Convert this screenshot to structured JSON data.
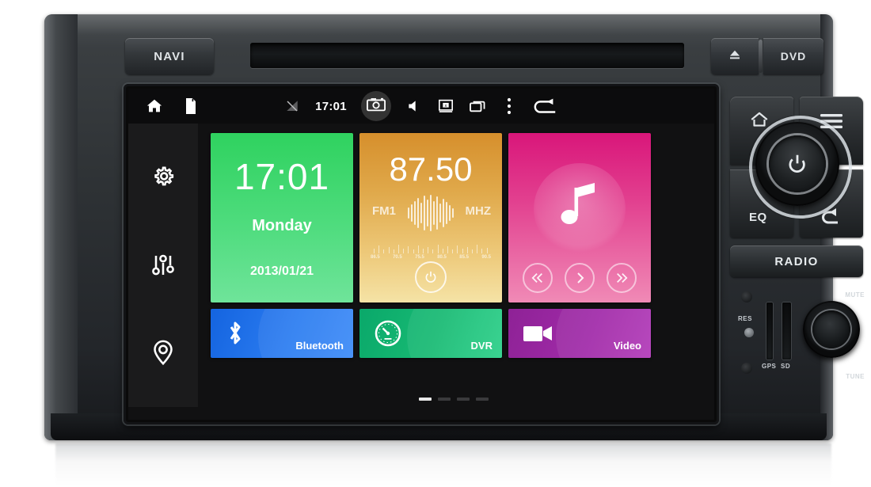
{
  "device": {
    "top_bezel": {
      "navi_label": "NAVI",
      "eject_icon": "eject-icon",
      "dvd_label": "DVD",
      "cd_slot": "cd-slot"
    },
    "right_panel": {
      "home_icon": "home-icon",
      "menu_icon": "menu-icon",
      "power_knob_icon": "power-knob-icon",
      "eq_label": "EQ",
      "back_icon": "back-arrow-icon",
      "radio_label": "RADIO"
    },
    "lower_panel": {
      "res_label": "RES",
      "gps_label": "GPS",
      "sd_label": "SD",
      "mute_label": "MUTE",
      "tune_label": "TUNE"
    }
  },
  "screen": {
    "statusbar": {
      "home_icon": "home-icon",
      "storage_icon": "sd-card-icon",
      "signal_off_icon": "signal-off-icon",
      "time": "17:01",
      "camera_icon": "camera-icon",
      "volume_icon": "volume-icon",
      "screen_off_icon": "screen-off-icon",
      "recents_icon": "recent-apps-icon",
      "overflow_icon": "overflow-menu-icon",
      "back_icon": "back-arrow-icon"
    },
    "sidebar": {
      "items": [
        {
          "name": "settings",
          "icon": "gear-icon"
        },
        {
          "name": "equalizer",
          "icon": "sliders-icon"
        },
        {
          "name": "navigation",
          "icon": "map-pin-icon"
        }
      ]
    },
    "tiles": {
      "clock": {
        "time": "17:01",
        "weekday": "Monday",
        "date": "2013/01/21",
        "color": "#4fdc7e"
      },
      "radio": {
        "frequency": "87.50",
        "band": "FM1",
        "unit": "MHZ",
        "power_icon": "power-icon",
        "dial_labels": [
          "86.5",
          "70.5",
          "75.5",
          "80.5",
          "85.5",
          "90.5"
        ],
        "color": "#e0a94b"
      },
      "music": {
        "icon": "music-note-icon",
        "prev_icon": "previous-track-icon",
        "play_icon": "play-icon",
        "next_icon": "next-track-icon",
        "color": "#e2408f"
      },
      "bluetooth": {
        "label": "Bluetooth",
        "icon": "bluetooth-icon",
        "color": "#2b7cf0"
      },
      "dvr": {
        "label": "DVR",
        "icon": "gauge-icon",
        "color": "#18bb74"
      },
      "video": {
        "label": "Video",
        "icon": "video-camera-icon",
        "color": "#a02aa8"
      }
    },
    "pager": {
      "pages": 4,
      "active": 1
    }
  }
}
